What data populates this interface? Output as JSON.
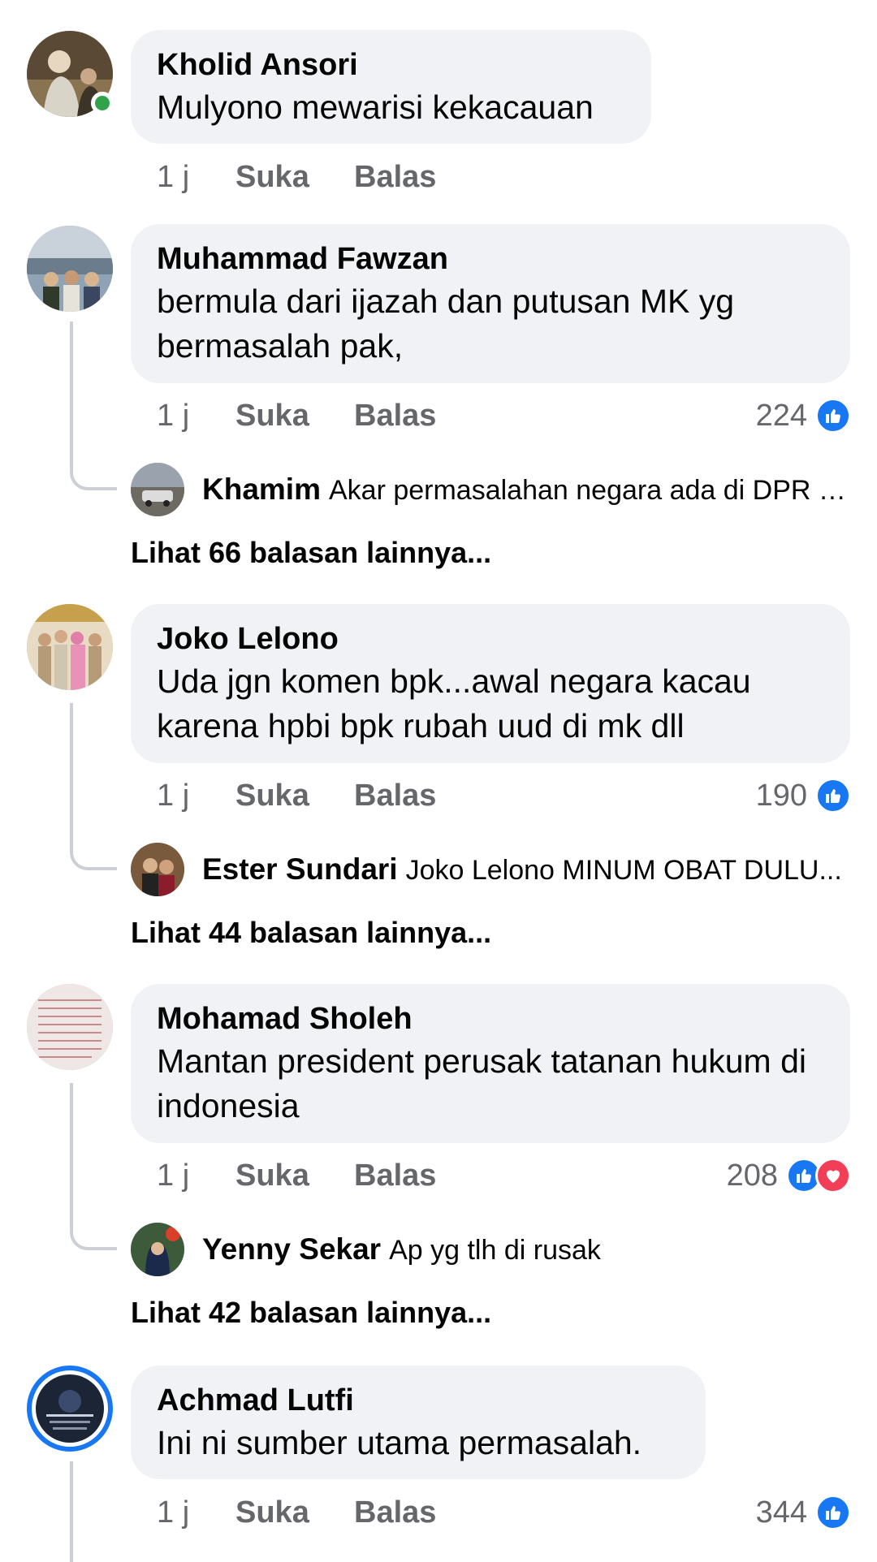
{
  "comments": [
    {
      "author": "Kholid Ansori",
      "text": "Mulyono mewarisi kekacauan",
      "time": "1 j",
      "like_label": "Suka",
      "reply_label": "Balas"
    },
    {
      "author": "Muhammad Fawzan",
      "text": "bermula dari ijazah dan putusan MK yg bermasalah pak,",
      "time": "1 j",
      "like_label": "Suka",
      "reply_label": "Balas",
      "reaction_count": "224",
      "reply_preview": {
        "author": "Khamim",
        "text": "Akar permasalahan negara ada di DPR dan MK"
      },
      "more_replies": "Lihat 66 balasan lainnya..."
    },
    {
      "author": "Joko Lelono",
      "text": "Uda jgn komen bpk...awal negara  kacau karena hpbi bpk rubah uud di mk dll",
      "time": "1 j",
      "like_label": "Suka",
      "reply_label": "Balas",
      "reaction_count": "190",
      "reply_preview": {
        "author": "Ester Sundari",
        "text": "Joko Lelono MINUM OBAT DULU..."
      },
      "more_replies": "Lihat 44 balasan lainnya..."
    },
    {
      "author": "Mohamad Sholeh",
      "text": "Mantan president perusak tatanan hukum di indonesia",
      "time": "1 j",
      "like_label": "Suka",
      "reply_label": "Balas",
      "reaction_count": "208",
      "reply_preview": {
        "author": "Yenny Sekar",
        "text": "Ap yg tlh di rusak"
      },
      "more_replies": "Lihat 42 balasan lainnya..."
    },
    {
      "author": "Achmad Lutfi",
      "text": "Ini ni sumber utama permasalah.",
      "time": "1 j",
      "like_label": "Suka",
      "reply_label": "Balas",
      "reaction_count": "344"
    }
  ],
  "icons": {
    "like": "thumbs-up-icon",
    "love": "heart-icon"
  },
  "colors": {
    "like_blue": "#1877f2",
    "love_red": "#f33e58",
    "online_green": "#31a24c",
    "bubble_bg": "#f0f2f5",
    "meta_gray": "#65676b"
  }
}
